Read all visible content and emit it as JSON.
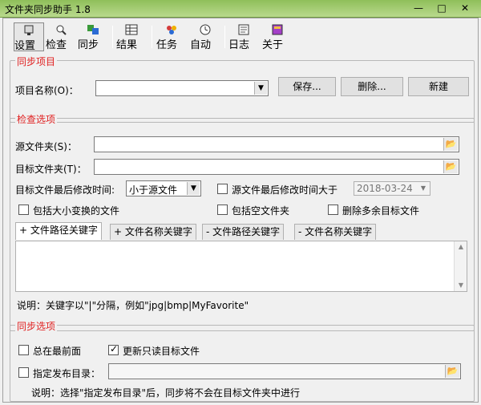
{
  "window": {
    "title": "文件夹同步助手 1.8",
    "controls": {
      "minimize": "—",
      "maximize": "□",
      "close": "✕"
    }
  },
  "toolbar": {
    "items": [
      {
        "label": "设置",
        "icon": "settings-icon"
      },
      {
        "label": "检查",
        "icon": "check-icon"
      },
      {
        "label": "同步",
        "icon": "sync-icon"
      },
      {
        "label": "结果",
        "icon": "results-icon"
      },
      {
        "label": "任务",
        "icon": "task-icon"
      },
      {
        "label": "自动",
        "icon": "clock-icon"
      },
      {
        "label": "日志",
        "icon": "log-icon"
      },
      {
        "label": "关于",
        "icon": "about-icon"
      }
    ]
  },
  "sync_project": {
    "legend": "同步项目",
    "project_name_label": "项目名称(O)：",
    "project_name_value": "",
    "save_label": "保存...",
    "delete_label": "删除...",
    "new_label": "新建"
  },
  "check_options": {
    "legend": "检查选项",
    "source_label": "源文件夹(S)：",
    "source_value": "",
    "target_label": "目标文件夹(T)：",
    "target_value": "",
    "mtime_label": "目标文件最后修改时间:",
    "mtime_selected": "小于源文件",
    "src_mtime_label": "源文件最后修改时间大于",
    "src_mtime_checked": false,
    "date_value": "2018-03-24",
    "include_case_label": "包括大小变换的文件",
    "include_case_checked": false,
    "include_empty_label": "包括空文件夹",
    "include_empty_checked": false,
    "delete_extra_label": "删除多余目标文件",
    "delete_extra_checked": false,
    "tabs": [
      "+ 文件路径关键字",
      "+ 文件名称关键字",
      "- 文件路径关键字",
      "- 文件名称关键字"
    ],
    "hint": "说明：关键字以\"|\"分隔，例如\"jpg|bmp|MyFavorite\""
  },
  "sync_options": {
    "legend": "同步选项",
    "always_on_top_label": "总在最前面",
    "always_on_top_checked": false,
    "update_readonly_label": "更新只读目标文件",
    "update_readonly_checked": true,
    "publish_dir_label": "指定发布目录：",
    "publish_dir_checked": false,
    "publish_dir_value": "",
    "hint": "说明：选择\"指定发布目录\"后，同步将不会在目标文件夹中进行"
  }
}
